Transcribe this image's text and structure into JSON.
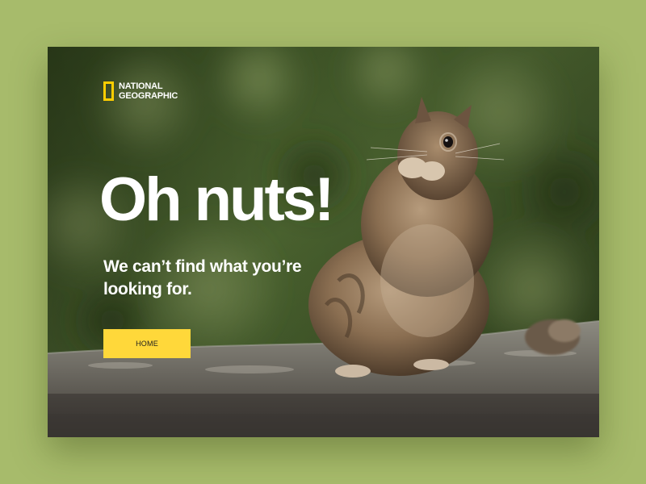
{
  "page": {
    "background_color": "#a7bb6b"
  },
  "brand": {
    "name_line1": "NATIONAL",
    "name_line2": "GEOGRAPHIC",
    "accent_color": "#ffce00"
  },
  "hero": {
    "headline": "Oh nuts!",
    "subheadline": "We can’t find what you’re looking for.",
    "image_subject": "ground squirrel eating a nut"
  },
  "actions": {
    "home_label": "HOME",
    "home_color": "#ffd83a"
  }
}
